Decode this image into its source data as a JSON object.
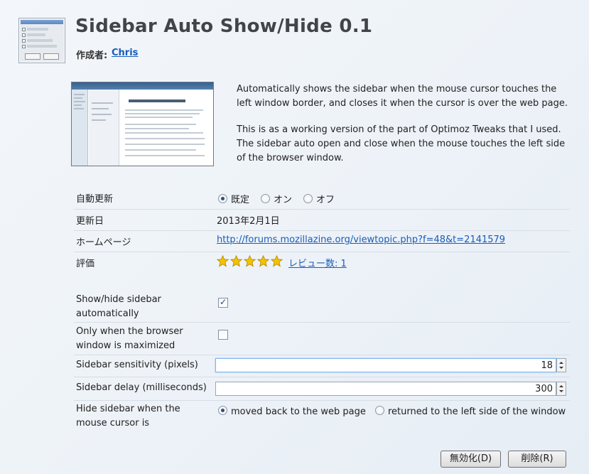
{
  "header": {
    "title": "Sidebar Auto Show/Hide 0.1",
    "author_label": "作成者:",
    "author_name": "Chris"
  },
  "description": {
    "p1": "Automatically shows the sidebar when the mouse cursor touches the left window border, and closes it when the cursor is over the web page.",
    "p2": "This is as a working version of the part of Optimoz Tweaks that I used. The sidebar auto open and close when the mouse touches the left side of the browser window."
  },
  "details": {
    "auto_update": {
      "label": "自動更新",
      "options": [
        "既定",
        "オン",
        "オフ"
      ],
      "selected": "既定"
    },
    "updated": {
      "label": "更新日",
      "value": "2013年2月1日"
    },
    "homepage": {
      "label": "ホームページ",
      "value": "http://forums.mozillazine.org/viewtopic.php?f=48&t=2141579"
    },
    "rating": {
      "label": "評価",
      "stars": 5,
      "reviews": "レビュー数: 1"
    }
  },
  "prefs": {
    "show_hide": {
      "label": "Show/hide sidebar automatically",
      "checked": true
    },
    "only_maximized": {
      "label": "Only when the browser window is maximized",
      "checked": false
    },
    "sensitivity": {
      "label": "Sidebar sensitivity (pixels)",
      "value": "18"
    },
    "delay": {
      "label": "Sidebar delay (milliseconds)",
      "value": "300"
    },
    "hide_when": {
      "label": "Hide sidebar when the mouse cursor is",
      "options": [
        "moved back to the web page",
        "returned to the left side of the window"
      ],
      "selected": "moved back to the web page"
    }
  },
  "buttons": {
    "disable": "無効化(D)",
    "remove": "削除(R)"
  },
  "colors": {
    "link": "#1a5cb8",
    "title": "#414549",
    "star": "#f2c300"
  },
  "icons": [
    "addon-icon",
    "star-icon",
    "checkbox-check-icon",
    "spin-up-icon",
    "spin-down-icon"
  ]
}
